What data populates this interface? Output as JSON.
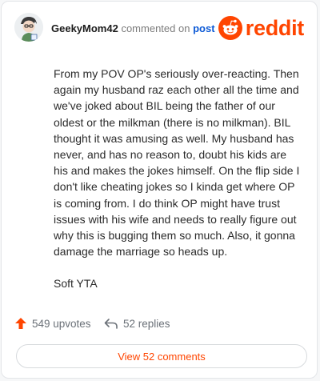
{
  "header": {
    "username": "GeekyMom42",
    "verb": "commented on",
    "link": "post",
    "brand": "reddit"
  },
  "comment": {
    "body": "From my POV OP's seriously over-reacting. Then again my husband raz each other all the time and we've joked about BIL being the father of our oldest or the milkman (there is no milkman). BIL thought it was amusing as well. My husband has never, and has no reason to, doubt his kids are his and makes the jokes himself. On the flip side I don't like cheating jokes so I kinda get where OP is coming from. I do think OP might have trust issues with his wife and needs to really figure out why this is bugging them so much. Also, it gonna damage the marriage so heads up.",
    "verdict": "Soft YTA"
  },
  "actions": {
    "upvotes": "549 upvotes",
    "replies": "52 replies",
    "view_button": "View 52 comments"
  },
  "icons": {
    "upvote": "arrow-up-icon",
    "reply": "reply-arrow-icon",
    "brand": "reddit-snoo-icon"
  },
  "colors": {
    "accent": "#ff4500",
    "link": "#0e5bd6"
  }
}
